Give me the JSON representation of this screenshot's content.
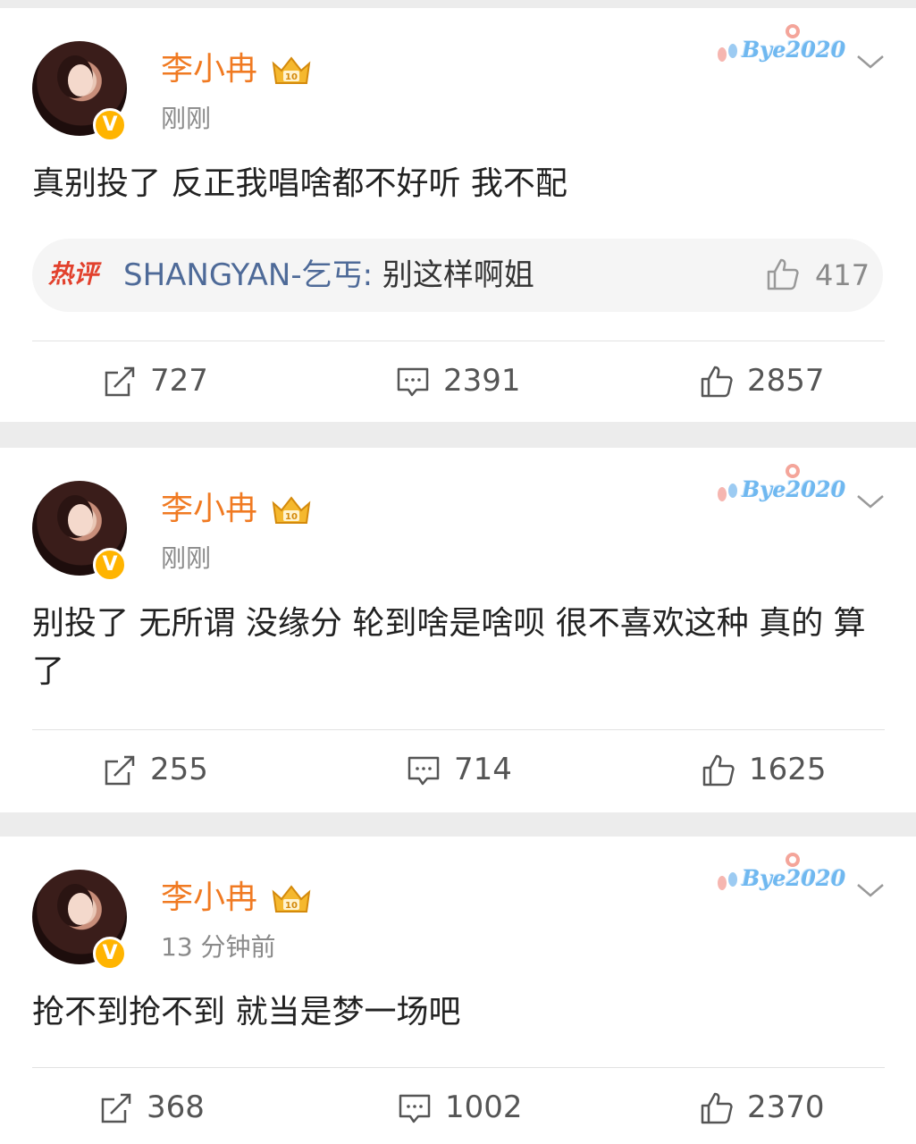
{
  "posts": [
    {
      "username": "李小冉",
      "timestamp": "刚刚",
      "text": "真别投了 反正我唱啥都不好听 我不配",
      "hot_comment": {
        "tag": "热评",
        "author": "SHANGYAN-乞丐",
        "separator": ": ",
        "text": "别这样啊姐",
        "likes": "417"
      },
      "reposts": "727",
      "comments": "2391",
      "likes": "2857"
    },
    {
      "username": "李小冉",
      "timestamp": "刚刚",
      "text": "别投了 无所谓 没缘分 轮到啥是啥呗 很不喜欢这种 真的 算了",
      "reposts": "255",
      "comments": "714",
      "likes": "1625"
    },
    {
      "username": "李小冉",
      "timestamp": "13 分钟前",
      "text": "抢不到抢不到 就当是梦一场吧",
      "reposts": "368",
      "comments": "1002",
      "likes": "2370"
    }
  ],
  "badge": {
    "crown_level": "10",
    "bye_text": "Bye2020"
  },
  "icons": {
    "verified": "verified-v-icon",
    "crown": "crown-badge-icon",
    "menu": "chevron-down-icon",
    "repost": "repost-icon",
    "comment": "comment-icon",
    "like": "thumbs-up-icon"
  },
  "colors": {
    "username": "#f07a22",
    "hot_tag": "#e2412d",
    "hot_author": "#4e6a98",
    "verified": "#ffb400",
    "background": "#ececec"
  }
}
